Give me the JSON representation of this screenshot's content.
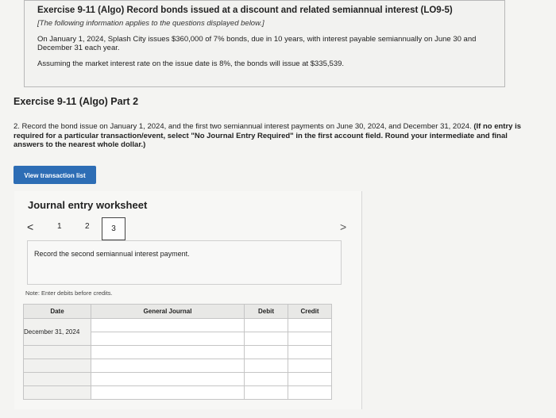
{
  "exercise": {
    "title": "Exercise 9-11 (Algo) Record bonds issued at a discount and related semiannual interest (LO9-5)",
    "note": "[The following information applies to the questions displayed below.]",
    "para1": "On January 1, 2024, Splash City issues $360,000 of 7% bonds, due in 10 years, with interest payable semiannually on June 30 and December 31 each year.",
    "para2": "Assuming the market interest rate on the issue date is 8%, the bonds will issue at $335,539."
  },
  "part_title": "Exercise 9-11 (Algo) Part 2",
  "question": {
    "text": "2. Record the bond issue on January 1, 2024, and the first two semiannual interest payments on June 30, 2024, and December 31, 2024. ",
    "bold": "(If no entry is required for a particular transaction/event, select \"No Journal Entry Required\" in the first account field. Round your intermediate and final answers to the nearest whole dollar.)"
  },
  "view_button": "View transaction list",
  "worksheet": {
    "title": "Journal entry worksheet",
    "pages": [
      "1",
      "2",
      "3"
    ],
    "prev": "<",
    "next": ">",
    "instruction": "Record the second semiannual interest payment.",
    "note": "Note: Enter debits before credits."
  },
  "table": {
    "headers": [
      "Date",
      "General Journal",
      "Debit",
      "Credit"
    ],
    "date_value": "December 31, 2024"
  }
}
